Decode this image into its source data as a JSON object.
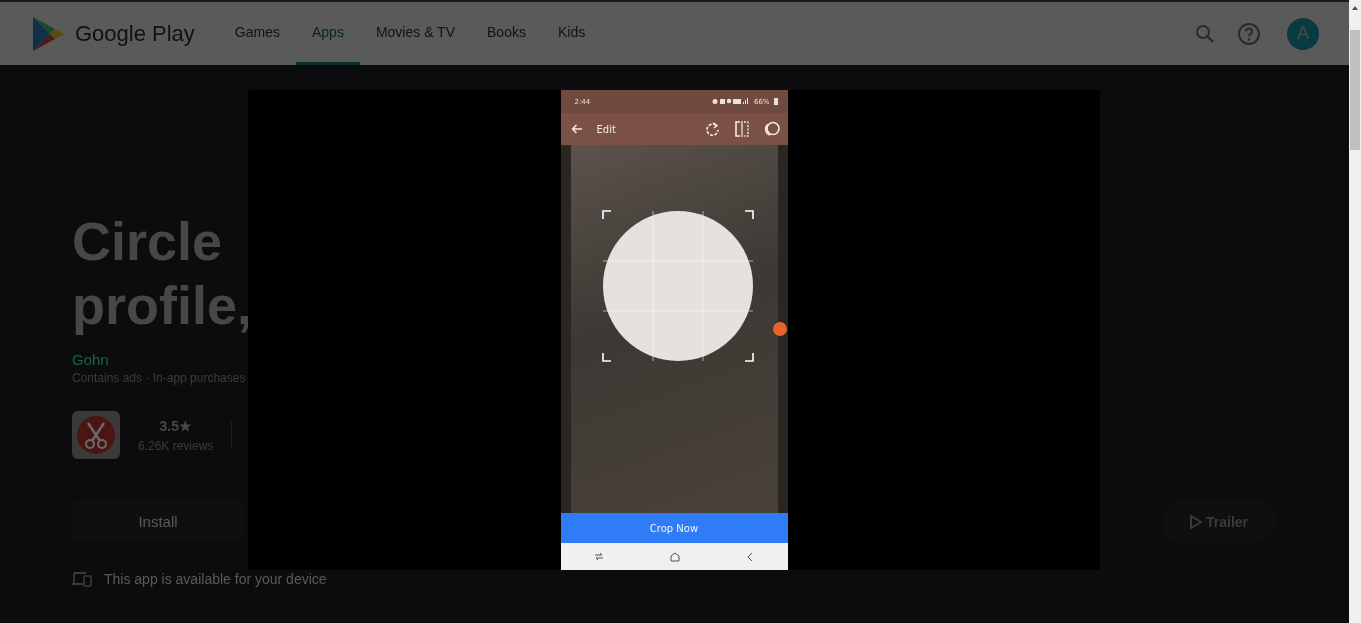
{
  "header": {
    "logo_text": "Google Play",
    "nav": [
      {
        "label": "Games",
        "selected": false
      },
      {
        "label": "Apps",
        "selected": true
      },
      {
        "label": "Movies & TV",
        "selected": false
      },
      {
        "label": "Books",
        "selected": false
      },
      {
        "label": "Kids",
        "selected": false
      }
    ],
    "avatar": "A"
  },
  "app": {
    "title_lines": [
      "Circle",
      "profile,"
    ],
    "developer": "Gohn",
    "meta": "Contains ads · In-app purchases",
    "rating": "3.5★",
    "reviews": "6.26K reviews",
    "install": "Install",
    "device_note": "This app is available for your device",
    "trailer": "Trailer"
  },
  "viewer": {
    "status_bar": {
      "time": "2:44",
      "battery": "66%"
    },
    "toolbar": {
      "title": "Edit"
    },
    "action_button": "Crop Now"
  }
}
